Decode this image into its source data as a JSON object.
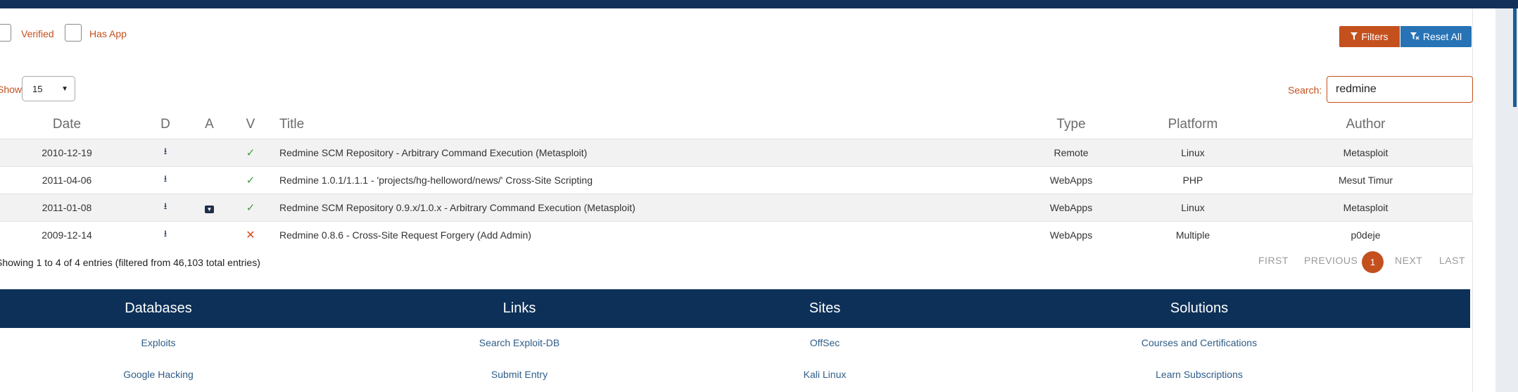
{
  "filters": {
    "verified_label": "Verified",
    "has_app_label": "Has App",
    "filters_button": "Filters",
    "reset_button": "Reset All"
  },
  "length_menu": {
    "label": "Show",
    "selected": "15"
  },
  "search": {
    "label": "Search:",
    "value": "redmine"
  },
  "table": {
    "headers": {
      "date": "Date",
      "download": "D",
      "app": "A",
      "verified": "V",
      "title": "Title",
      "type": "Type",
      "platform": "Platform",
      "author": "Author"
    },
    "rows": [
      {
        "date": "2010-12-19",
        "has_app": false,
        "verified": true,
        "title": "Redmine SCM Repository - Arbitrary Command Execution (Metasploit)",
        "type": "Remote",
        "platform": "Linux",
        "author": "Metasploit"
      },
      {
        "date": "2011-04-06",
        "has_app": false,
        "verified": true,
        "title": "Redmine 1.0.1/1.1.1 - 'projects/hg-helloword/news/' Cross-Site Scripting",
        "type": "WebApps",
        "platform": "PHP",
        "author": "Mesut Timur"
      },
      {
        "date": "2011-01-08",
        "has_app": true,
        "verified": true,
        "title": "Redmine SCM Repository 0.9.x/1.0.x - Arbitrary Command Execution (Metasploit)",
        "type": "WebApps",
        "platform": "Linux",
        "author": "Metasploit"
      },
      {
        "date": "2009-12-14",
        "has_app": false,
        "verified": false,
        "title": "Redmine 0.8.6 - Cross-Site Request Forgery (Add Admin)",
        "type": "WebApps",
        "platform": "Multiple",
        "author": "p0deje"
      }
    ]
  },
  "info_text": "Showing 1 to 4 of 4 entries (filtered from 46,103 total entries)",
  "pagination": {
    "first": "FIRST",
    "previous": "PREVIOUS",
    "current": "1",
    "next": "NEXT",
    "last": "LAST"
  },
  "footer": {
    "databases": {
      "heading": "Databases",
      "links": [
        "Exploits",
        "Google Hacking"
      ]
    },
    "links": {
      "heading": "Links",
      "links": [
        "Search Exploit-DB",
        "Submit Entry"
      ]
    },
    "sites": {
      "heading": "Sites",
      "links": [
        "OffSec",
        "Kali Linux"
      ]
    },
    "solutions": {
      "heading": "Solutions",
      "links": [
        "Courses and Certifications",
        "Learn Subscriptions"
      ]
    }
  },
  "icons": {
    "download": "download-icon",
    "app": "archive-icon",
    "verified": "check-icon",
    "unverified": "x-icon",
    "filter": "filter-icon",
    "reset": "filter-reset-icon"
  },
  "colors": {
    "accent": "#c4501e",
    "reset_button": "#2773b6",
    "navy": "#0d3058",
    "link": "#2e5d87",
    "verified": "#3f9a3f",
    "unverified": "#d24b1e"
  }
}
